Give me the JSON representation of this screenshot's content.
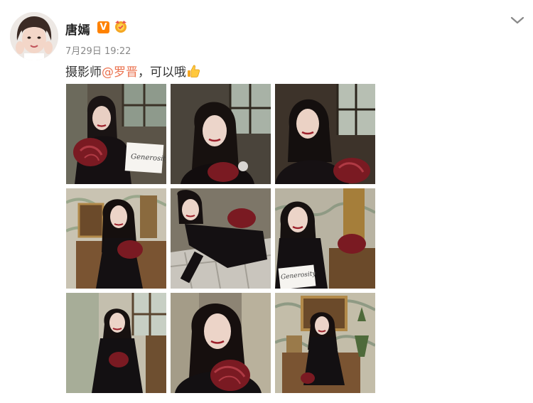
{
  "post": {
    "username": "唐嫣",
    "vip_badge": "V",
    "medal": "medal-icon",
    "timestamp": "7月29日 19:22",
    "text_before": "摄影师",
    "mention": "@罗晋",
    "text_after": "，可以哦",
    "emoji": "thumbs-up-emoji",
    "menu_icon": "chevron-down-icon"
  },
  "colors": {
    "mention": "#eb7350",
    "vip": "#ff8200",
    "timestamp": "#888888"
  },
  "photos": [
    {
      "name": "photo-1",
      "note_text": "Generosity"
    },
    {
      "name": "photo-2"
    },
    {
      "name": "photo-3"
    },
    {
      "name": "photo-4"
    },
    {
      "name": "photo-5"
    },
    {
      "name": "photo-6",
      "note_text": "Generosity"
    },
    {
      "name": "photo-7"
    },
    {
      "name": "photo-8"
    },
    {
      "name": "photo-9"
    }
  ]
}
